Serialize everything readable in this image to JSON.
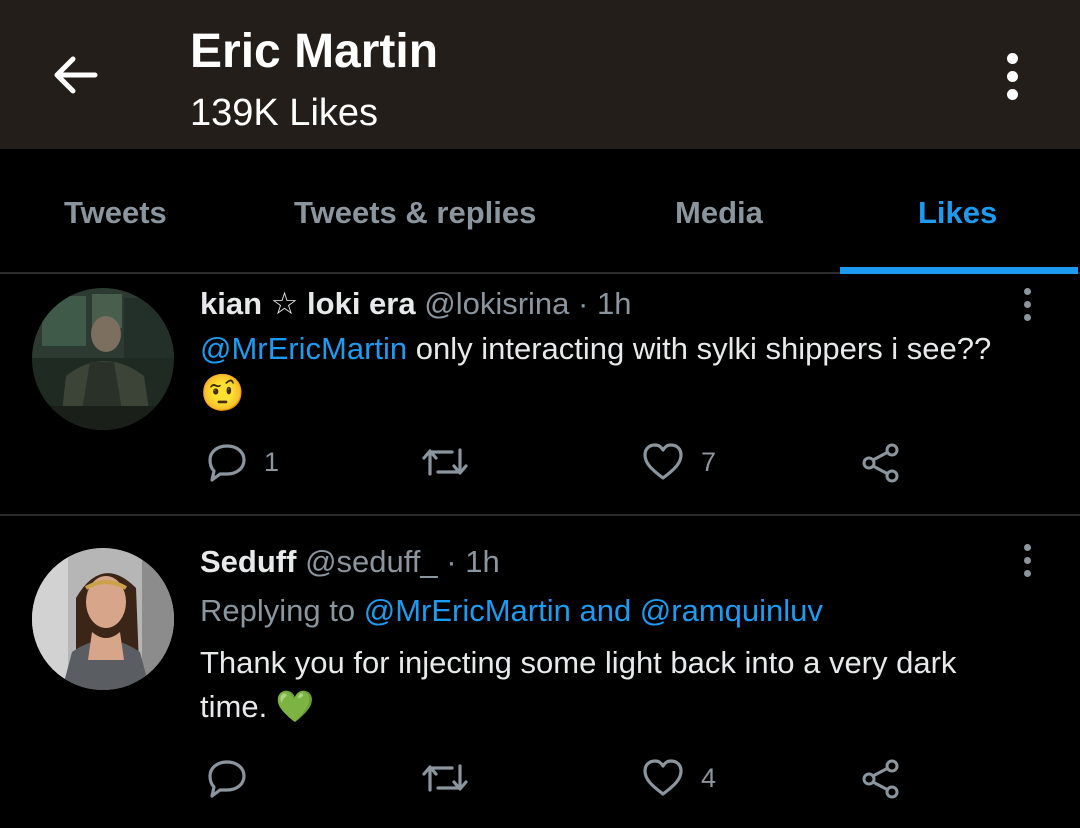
{
  "header": {
    "title": "Eric Martin",
    "subtitle": "139K Likes",
    "back_icon": "arrow-left-icon",
    "more_icon": "more-vertical-icon"
  },
  "tabs": [
    {
      "label": "Tweets",
      "active": false
    },
    {
      "label": "Tweets & replies",
      "active": false
    },
    {
      "label": "Media",
      "active": false
    },
    {
      "label": "Likes",
      "active": true
    }
  ],
  "tweets": [
    {
      "display_name": "kian ☆ loki era",
      "handle": "@lokisrina",
      "time": "· 1h",
      "mention": "@MrEricMartin",
      "text": "only interacting with sylki shippers i see??",
      "emoji": "🤨",
      "actions": {
        "reply": "1",
        "retweet": "",
        "like": "7"
      }
    },
    {
      "display_name": "Seduff",
      "handle": "@seduff_",
      "time": "· 1h",
      "replying_prefix": "Replying to",
      "replying_to": "@MrEricMartin and @ramquinluv",
      "text_line1": "Thank you for injecting some light back into a very dark",
      "text_line2": "time.",
      "emoji": "💚",
      "actions": {
        "reply": "",
        "retweet": "",
        "like": "4"
      }
    }
  ],
  "colors": {
    "header_bg": "#231e19",
    "background": "#000000",
    "accent": "#1d9bf0",
    "muted": "#8b959e",
    "divider": "#2c2c2c"
  }
}
